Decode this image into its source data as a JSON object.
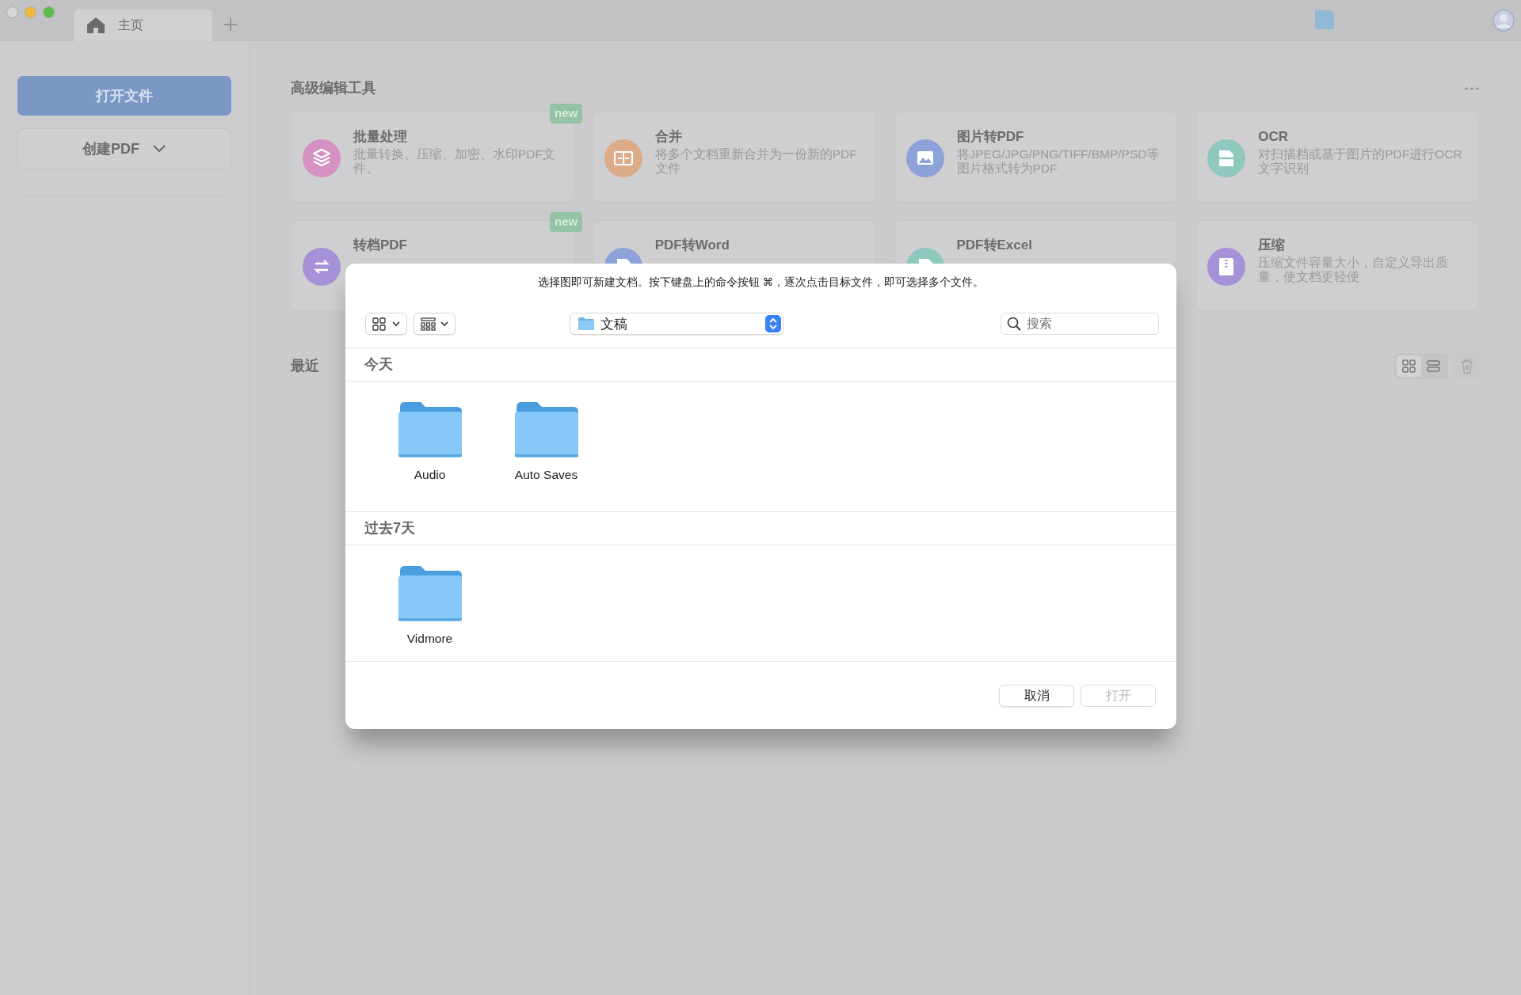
{
  "tabs": [
    {
      "label": "主页",
      "selected": true
    }
  ],
  "sidebar": {
    "open_button": "打开文件",
    "create_button": "创建PDF"
  },
  "tools": {
    "title": "高级编辑工具",
    "cards": [
      {
        "kind": "batch",
        "title": "批量处理",
        "description": "批量转换、压缩、加密、水印PDF文件。",
        "badge": "new",
        "color": "#d591c1"
      },
      {
        "kind": "merge",
        "title": "合并",
        "description": "将多个文档重新合并为一份新的PDF文件",
        "color": "#dcab87"
      },
      {
        "kind": "image",
        "title": "图片转PDF",
        "description": "将JPEG/JPG/PNG/TIFF/BMP/PSD等图片格式转为PDF",
        "color": "#8da2d8"
      },
      {
        "kind": "ocr",
        "title": "OCR",
        "description": "对扫描档或基于图片的PDF进行OCR文字识别",
        "color": "#8fc8bd"
      },
      {
        "kind": "convert",
        "title": "转档PDF",
        "badge": "new",
        "color": "#a592d8"
      },
      {
        "kind": "word",
        "title": "PDF转Word",
        "color": "#8da2d8"
      },
      {
        "kind": "excel",
        "title": "PDF转Excel",
        "color": "#8fc8bd"
      },
      {
        "kind": "zip",
        "title": "压缩",
        "description": "压缩文件容量大小，自定义导出质量，使文档更轻便",
        "color": "#a592d8"
      }
    ]
  },
  "recent": {
    "title": "最近",
    "view_buttons": [
      {
        "kind": "grid",
        "selected": true
      },
      {
        "kind": "list",
        "selected": false
      }
    ]
  },
  "dialog": {
    "hint": "选择图即可新建文档。按下键盘上的命令按钮 ⌘，逐次点击目标文件，即可选择多个文件。",
    "view_buttons": [
      {
        "kind": "icons"
      },
      {
        "kind": "gallery"
      }
    ],
    "location": "文稿",
    "search": {
      "placeholder": "搜索"
    },
    "sections": [
      {
        "title": "今天",
        "items": [
          {
            "name": "Audio"
          },
          {
            "name": "Auto Saves"
          }
        ]
      },
      {
        "title": "过去7天",
        "items": [
          {
            "name": "Vidmore"
          }
        ]
      }
    ],
    "buttons": [
      {
        "label": "取消",
        "disabled": false
      },
      {
        "label": "打开",
        "disabled": true
      }
    ]
  }
}
